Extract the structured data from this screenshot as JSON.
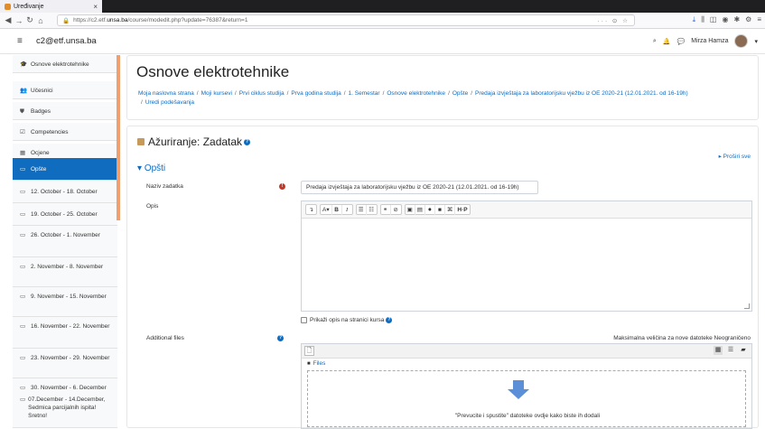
{
  "browser": {
    "tab_title": "Uređivanje",
    "tab_close": "×",
    "url_prefix": "https://c2.etf.",
    "url_domain": "unsa.ba",
    "url_path": "/course/modedit.php?update=76387&return=1",
    "url_right": "··· ⊙ ☆"
  },
  "header": {
    "site_name": "c2@etf.unsa.ba",
    "user_name": "Mirza Hamza"
  },
  "sidebar": {
    "items": [
      {
        "label": "Osnove elektrotehnike",
        "icon": "graduation-cap-icon",
        "glyph": "🎓"
      },
      {
        "label": "Učesnici",
        "icon": "users-icon",
        "glyph": "👥"
      },
      {
        "label": "Badges",
        "icon": "shield-icon",
        "glyph": "⛊"
      },
      {
        "label": "Competencies",
        "icon": "check-square-icon",
        "glyph": "☑"
      },
      {
        "label": "Ocjene",
        "icon": "table-icon",
        "glyph": "▦"
      },
      {
        "label": "Opšte",
        "icon": "folder-icon",
        "glyph": "▭"
      },
      {
        "label": "12. October - 18. October",
        "icon": "folder-icon",
        "glyph": "▭"
      },
      {
        "label": "19. October - 25. October",
        "icon": "folder-icon",
        "glyph": "▭"
      },
      {
        "label": "26. October - 1. November",
        "icon": "folder-icon",
        "glyph": "▭"
      },
      {
        "label": "2. November - 8. November",
        "icon": "folder-icon",
        "glyph": "▭"
      },
      {
        "label": "9. November - 15. November",
        "icon": "folder-icon",
        "glyph": "▭"
      },
      {
        "label": "16. November - 22. November",
        "icon": "folder-icon",
        "glyph": "▭"
      },
      {
        "label": "23. November - 29. November",
        "icon": "folder-icon",
        "glyph": "▭"
      },
      {
        "label": "30. November - 6. December",
        "icon": "folder-icon",
        "glyph": "▭"
      },
      {
        "label": "07.December - 14.December, Sedmica parcijalnih ispita! Sretno!",
        "icon": "folder-icon",
        "glyph": "▭"
      }
    ]
  },
  "page": {
    "title": "Osnove elektrotehnike",
    "breadcrumbs": [
      "Moja naslovna strana",
      "Moji kursevi",
      "Prvi ciklus studija",
      "Prva godina studija",
      "1. Semestar",
      "Osnove elektrotehnike",
      "Opšte",
      "Predaja izvještaja za laboratorijsku vježbu iz OE 2020-21 (12.01.2021. od 16-19h)",
      "Uredi podešavanja"
    ]
  },
  "form": {
    "heading": "Ažuriranje: Zadatak",
    "expand_all": "▸ Proširi sve",
    "section": "Opšti",
    "section_chevron": "▾",
    "name_label": "Naziv zadatka",
    "name_value": "Predaja izvještaja za laboratorijsku vježbu iz OE 2020-21 (12.01.2021. od 16-19h)",
    "desc_label": "Opis",
    "show_desc_label": "Prikaži opis na stranici kursa",
    "files_label": "Additional files",
    "max_size": "Maksimalna veličina za nove datoteke Neograničeno",
    "files_path": "Files",
    "drop_text": "\"Prevucite i spustite\" datoteke ovdje kako biste ih dodali"
  },
  "colors": {
    "accent": "#0f6cbf",
    "required": "#c0392b",
    "drawer_scroll": "#f0a070"
  }
}
